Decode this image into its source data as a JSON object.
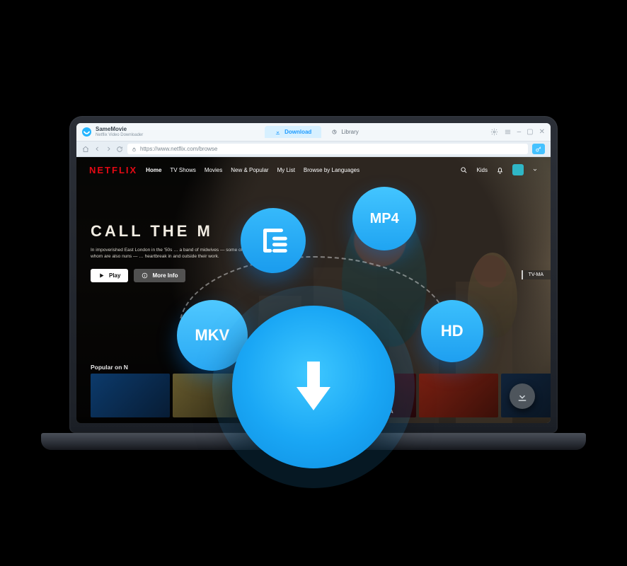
{
  "app": {
    "name": "SameMovie",
    "subtitle": "Netflix Video Downloader",
    "tabs": {
      "download": "Download",
      "library": "Library"
    }
  },
  "browser": {
    "url": "https://www.netflix.com/browse"
  },
  "netflix": {
    "logo": "NETFLIX",
    "nav": [
      "Home",
      "TV Shows",
      "Movies",
      "New & Popular",
      "My List",
      "Browse by Languages"
    ],
    "top_right": {
      "kids": "Kids"
    },
    "hero": {
      "title_visible": "CALL THE M",
      "description": "In impoverished East London in the '50s …\na band of midwives — some of whom are also nuns — …\nheartbreak in and outside their work.",
      "play": "Play",
      "more": "More Info",
      "rating": "TV-MA"
    },
    "row_label": "Popular on N",
    "thumbs": [
      {
        "label": "",
        "bg": "linear-gradient(135deg,#0c3a6b,#071c34)"
      },
      {
        "label": "",
        "bg": "linear-gradient(135deg,#665a2d,#2e2814)"
      },
      {
        "label": "",
        "bg": "linear-gradient(135deg,#123a2e,#071b15)"
      },
      {
        "label": "BALLERINA",
        "bg": "linear-gradient(135deg,#5a0e14,#26070a)"
      },
      {
        "label": "",
        "bg": "linear-gradient(135deg,#7a2012,#3a0f08)"
      },
      {
        "label": "",
        "bg": "linear-gradient(135deg,#10233a,#07111c)"
      }
    ]
  },
  "bubbles": {
    "mp4": "MP4",
    "mkv": "MKV",
    "hd": "HD"
  }
}
